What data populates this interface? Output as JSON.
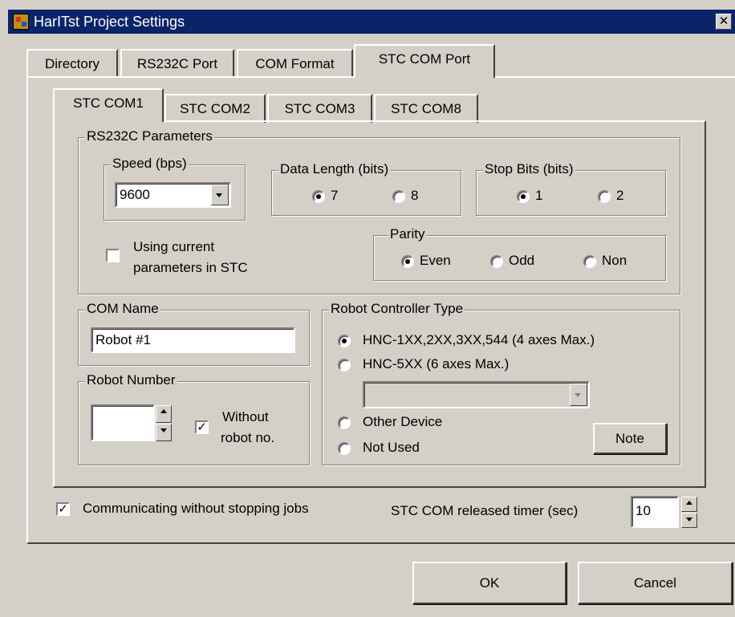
{
  "window": {
    "title": "HarITst Project Settings"
  },
  "main_tabs": [
    {
      "label": "Directory"
    },
    {
      "label": "RS232C Port"
    },
    {
      "label": "COM Format"
    },
    {
      "label": "STC COM Port"
    }
  ],
  "sub_tabs": [
    {
      "label": "STC COM1"
    },
    {
      "label": "STC COM2"
    },
    {
      "label": "STC COM3"
    },
    {
      "label": "STC COM8"
    }
  ],
  "rs232c": {
    "label": "RS232C Parameters",
    "speed": {
      "label": "Speed (bps)",
      "value": "9600"
    },
    "data_length": {
      "label": "Data Length (bits)",
      "options": [
        "7",
        "8"
      ],
      "selected": "7"
    },
    "stop_bits": {
      "label": "Stop Bits (bits)",
      "options": [
        "1",
        "2"
      ],
      "selected": "1"
    },
    "use_current": {
      "label_line1": "Using current",
      "label_line2": "parameters in STC",
      "checked": false
    },
    "parity": {
      "label": "Parity",
      "options": [
        "Even",
        "Odd",
        "Non"
      ],
      "selected": "Even"
    }
  },
  "com_name": {
    "label": "COM Name",
    "value": "Robot #1"
  },
  "robot_number": {
    "label": "Robot Number",
    "value": "",
    "without_line1": "Without",
    "without_line2": "robot no.",
    "without_checked": true
  },
  "controller": {
    "label": "Robot Controller Type",
    "options": [
      "HNC-1XX,2XX,3XX,544 (4 axes Max.)",
      "HNC-5XX (6 axes Max.)",
      "Other Device",
      "Not Used"
    ],
    "selected": "HNC-1XX,2XX,3XX,544 (4 axes Max.)",
    "combo_value": "",
    "note_label": "Note"
  },
  "bottom": {
    "communicating_label": "Communicating without stopping jobs",
    "communicating_checked": true,
    "timer_label": "STC COM released timer (sec)",
    "timer_value": "10"
  },
  "buttons": {
    "ok": "OK",
    "cancel": "Cancel"
  }
}
